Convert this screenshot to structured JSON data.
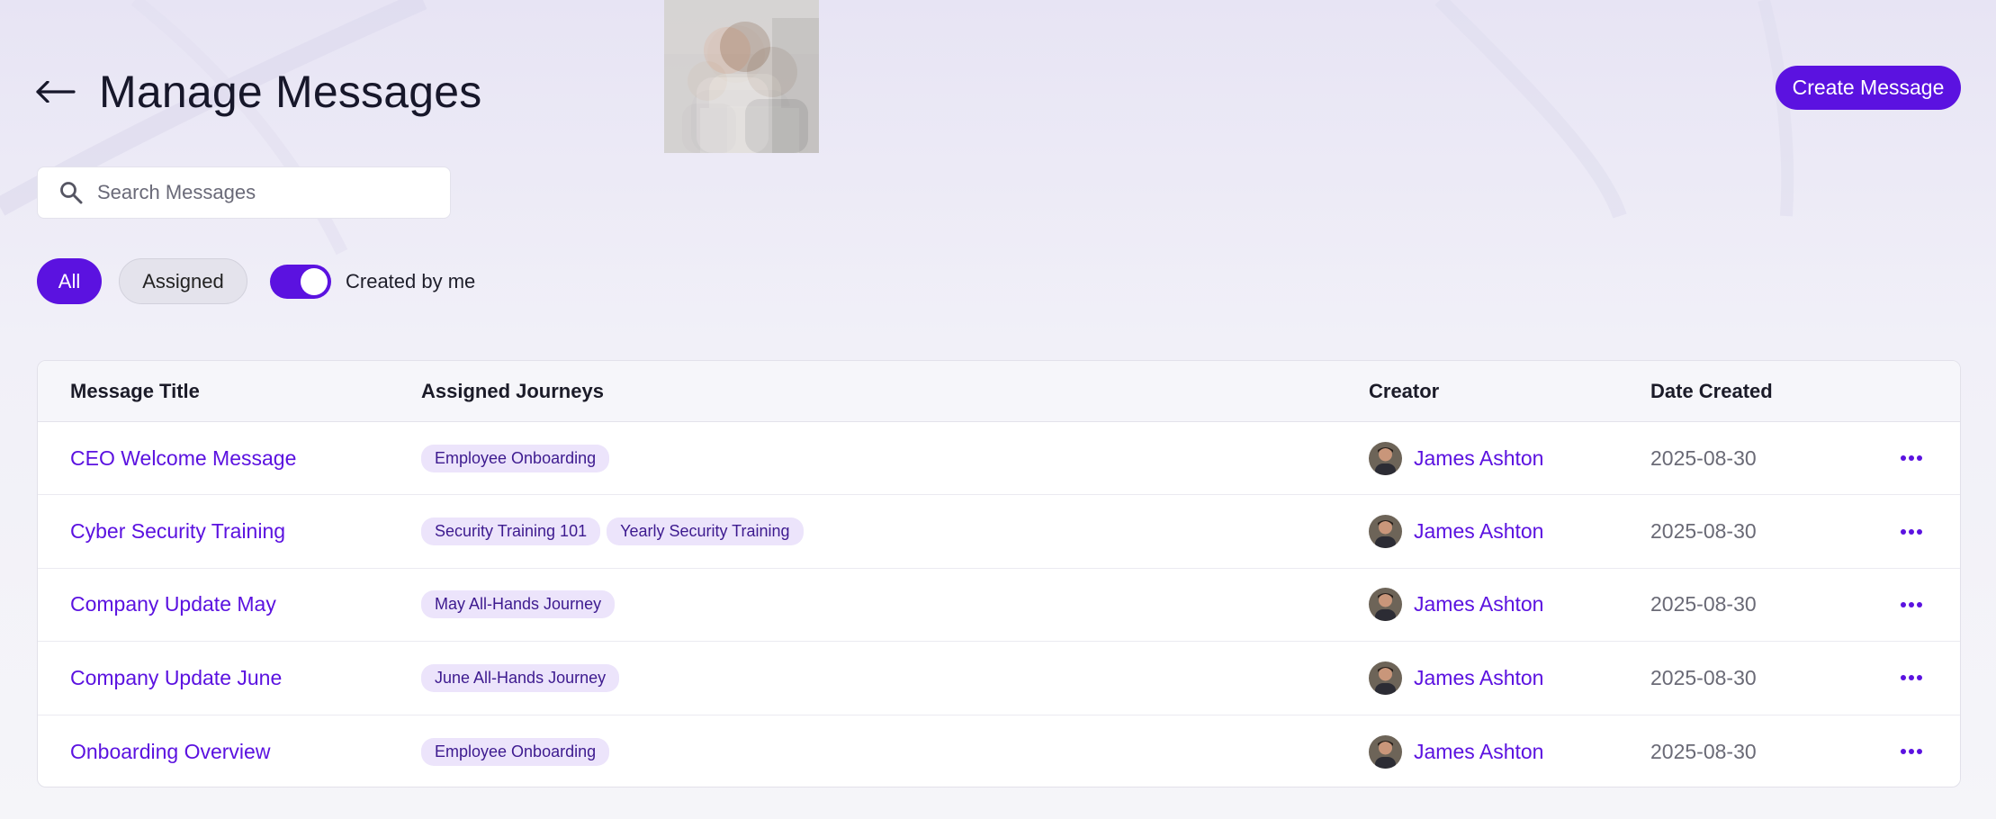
{
  "header": {
    "title": "Manage Messages",
    "create_label": "Create Message"
  },
  "search": {
    "placeholder": "Search Messages",
    "value": ""
  },
  "filters": {
    "all_label": "All",
    "assigned_label": "Assigned",
    "created_by_me_label": "Created by me",
    "created_by_me_on": true
  },
  "table": {
    "headers": {
      "title": "Message Title",
      "journeys": "Assigned Journeys",
      "creator": "Creator",
      "date": "Date Created"
    },
    "rows": [
      {
        "title": "CEO Welcome Message",
        "journeys": [
          "Employee Onboarding"
        ],
        "creator": "James Ashton",
        "date": "2025-08-30"
      },
      {
        "title": "Cyber Security Training",
        "journeys": [
          "Security Training 101",
          "Yearly Security Training"
        ],
        "creator": "James Ashton",
        "date": "2025-08-30"
      },
      {
        "title": "Company Update May",
        "journeys": [
          "May All-Hands Journey"
        ],
        "creator": "James Ashton",
        "date": "2025-08-30"
      },
      {
        "title": "Company Update June",
        "journeys": [
          "June All-Hands Journey"
        ],
        "creator": "James Ashton",
        "date": "2025-08-30"
      },
      {
        "title": "Onboarding Overview",
        "journeys": [
          "Employee Onboarding"
        ],
        "creator": "James Ashton",
        "date": "2025-08-30"
      }
    ]
  },
  "colors": {
    "accent": "#5b12e0",
    "tag_bg": "#ece4fb",
    "tag_text": "#3d1a8f"
  },
  "icons": {
    "back": "arrow-left-icon",
    "search": "search-icon",
    "more": "more-horizontal-icon"
  }
}
